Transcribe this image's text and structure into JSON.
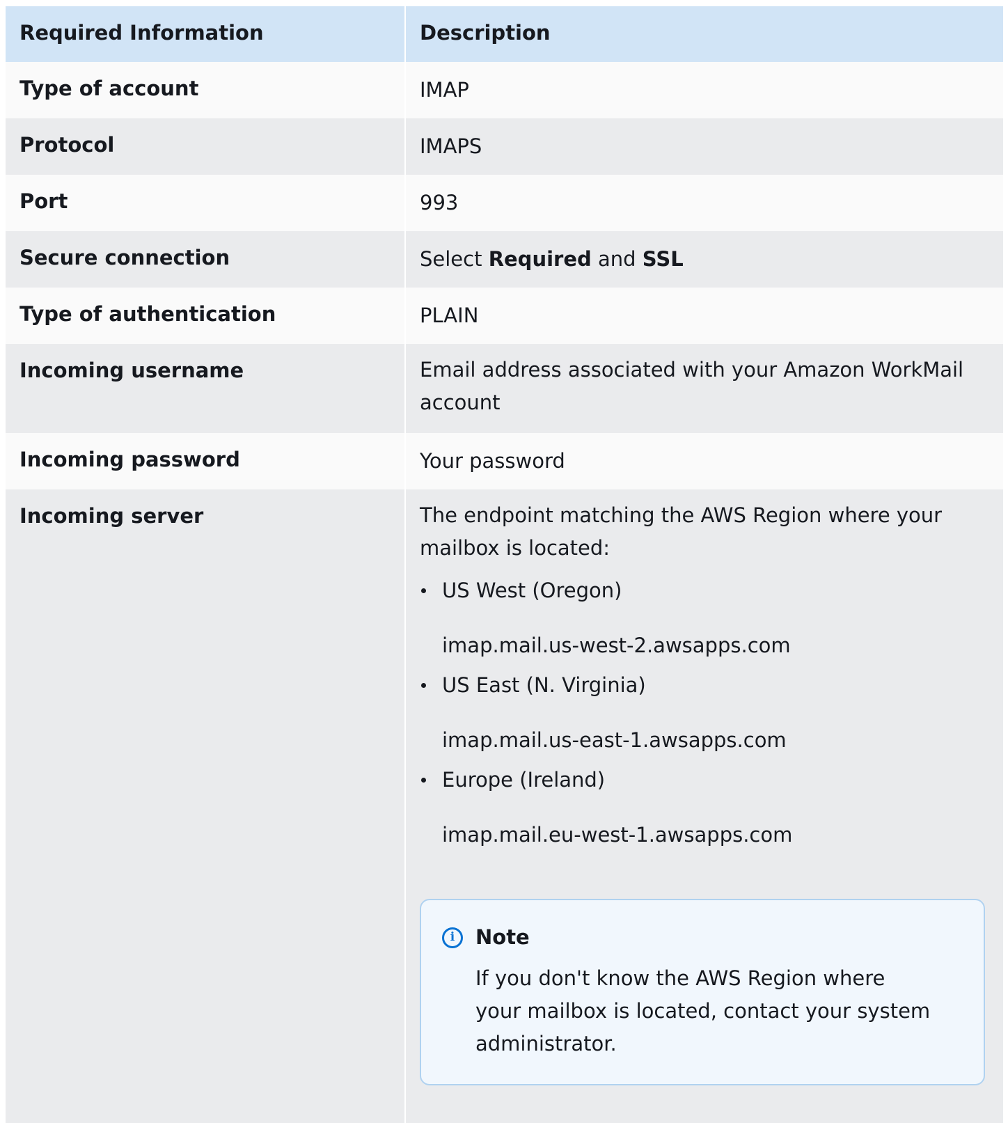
{
  "table": {
    "headers": [
      "Required Information",
      "Description"
    ],
    "rows": [
      {
        "label": "Type of account",
        "value": "IMAP"
      },
      {
        "label": "Protocol",
        "value": "IMAPS"
      },
      {
        "label": "Port",
        "value": "993"
      },
      {
        "label": "Secure connection",
        "value_parts": [
          "Select ",
          "Required",
          " and ",
          "SSL"
        ]
      },
      {
        "label": "Type of authentication",
        "value": "PLAIN"
      },
      {
        "label": "Incoming username",
        "value": "Email address associated with your Amazon WorkMail account"
      },
      {
        "label": "Incoming password",
        "value": "Your password"
      },
      {
        "label": "Incoming server",
        "intro": "The endpoint matching the AWS Region where your mailbox is located:",
        "regions": [
          {
            "name": "US West (Oregon)",
            "host": "imap.mail.us-west-2.awsapps.com"
          },
          {
            "name": "US East (N. Virginia)",
            "host": "imap.mail.us-east-1.awsapps.com"
          },
          {
            "name": "Europe (Ireland)",
            "host": "imap.mail.eu-west-1.awsapps.com"
          }
        ],
        "note": {
          "icon": "info-icon",
          "title": "Note",
          "text": "If you don't know the AWS Region where your mailbox is located, contact your system administrator."
        }
      }
    ]
  },
  "colors": {
    "header_bg": "#d1e4f6",
    "row_light": "#fafafa",
    "row_dark": "#eaebed",
    "note_bg": "#f1f7fd",
    "note_border": "#b0d2f0",
    "info_blue": "#0972d3"
  }
}
